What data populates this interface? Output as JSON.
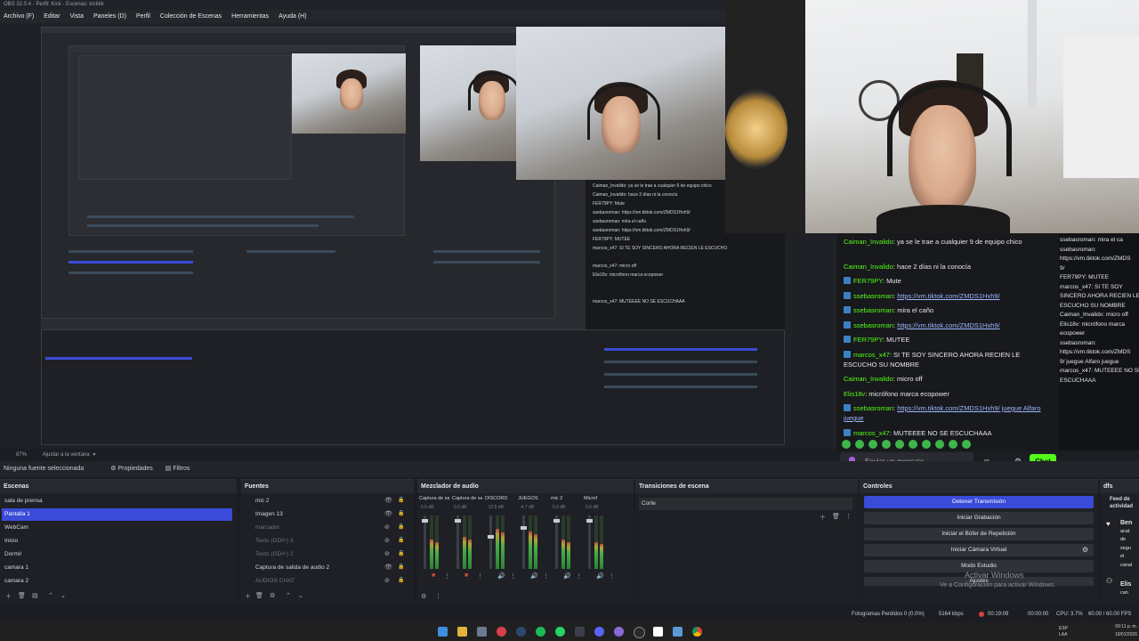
{
  "window": {
    "title": "OBS 32.0.4 - Perfil: Kick - Escenas: kickkk"
  },
  "menu": [
    "Archivo (F)",
    "Editar",
    "Vista",
    "Paneles (D)",
    "Perfil",
    "Colección de Escenas",
    "Herramientas",
    "Ayuda (H)"
  ],
  "zoom": {
    "value": "87%",
    "fit": "Ajustar a la ventana"
  },
  "source_bar": {
    "none_selected": "Ninguna fuente seleccionada",
    "properties": "Propiedades",
    "filters": "Filtros"
  },
  "chat": {
    "messages": [
      {
        "user": "Caiman_Invalido",
        "text": "ya se le trae a cualquier 9 de equipo chico",
        "badge": false
      },
      {
        "user": "Caiman_Invalido",
        "text": "hace 2 días ni la conocía",
        "badge": false
      },
      {
        "user": "FER79PY",
        "text": "Mute",
        "badge": true
      },
      {
        "user": "ssebasroman",
        "text": "https://vm.tiktok.com/ZMDS1Hxh9/",
        "badge": true,
        "link": true
      },
      {
        "user": "ssebasroman",
        "text": "mira el caño",
        "badge": true
      },
      {
        "user": "ssebasroman",
        "text": "https://vm.tiktok.com/ZMDS1Hxh9/",
        "badge": true,
        "link": true
      },
      {
        "user": "FER79PY",
        "text": "MUTEE",
        "badge": true
      },
      {
        "user": "marcos_x47",
        "text": "SI TE SOY SINCERO AHORA RECIEN LE ESCUCHO SU NOMBRE",
        "badge": true
      },
      {
        "user": "Caiman_Invalido",
        "text": "micro off",
        "badge": false
      },
      {
        "user": "Elis18v",
        "text": "micrófono marca ecopower",
        "badge": false
      },
      {
        "user": "ssebasroman",
        "text": "https://vm.tiktok.com/ZMDS1Hxh9/ juegue Alfaro juegue",
        "badge": true,
        "link": true
      },
      {
        "user": "marcos_x47",
        "text": "MUTEEEE NO SE ESCUCHAAA",
        "badge": true
      }
    ],
    "input_placeholder": "Enviar un mensaje",
    "send_label": "Chat",
    "right_column": [
      "ssebasroman: mira el ca",
      "ssebasroman:",
      "https://vm.tiktok.com/ZMDS",
      "9/",
      "FER79PY: MUTEE",
      "marcos_x47: SI TE SOY",
      "SINCERO AHORA RECIEN LE",
      "ESCUCHO SU NOMBRE",
      "Caiman_Invalido: micro off",
      "Elis18v: micrófono marca",
      "ecopower",
      "ssebasroman:",
      "https://vm.tiktok.com/ZMDS",
      "9/ juegue Alfaro juegue",
      "marcos_x47: MUTEEEE NO SE",
      "ESCUCHAAA"
    ]
  },
  "scenes": {
    "title": "Escenas",
    "items": [
      "sala de prensa",
      "Pantalla 1",
      "WebCam",
      "Inicio",
      "Dormir",
      "camara 1",
      "camara 2"
    ],
    "selected": 1
  },
  "sources": {
    "title": "Fuentes",
    "items": [
      {
        "label": "mic 2",
        "visible": true
      },
      {
        "label": "Imagen 13",
        "visible": true
      },
      {
        "label": "marcador",
        "visible": false
      },
      {
        "label": "Texto (GDI+) 3",
        "visible": false
      },
      {
        "label": "Texto (GDI+) 2",
        "visible": false
      },
      {
        "label": "Captura de salida de audio 2",
        "visible": true
      },
      {
        "label": "AUDIOS CHAT",
        "visible": false
      }
    ]
  },
  "mixer": {
    "title": "Mezclador de audio",
    "channels": [
      {
        "name": "Captura de salida d",
        "db": "0.0 dB"
      },
      {
        "name": "Captura de salida d",
        "db": "0.0 dB"
      },
      {
        "name": "DISCORD",
        "db": "-12.5 dB"
      },
      {
        "name": "JUEGOS",
        "db": "-4.7 dB"
      },
      {
        "name": "mic 2",
        "db": "0.0 dB"
      },
      {
        "name": "Microf",
        "db": "0.0 dB"
      }
    ]
  },
  "transitions": {
    "title": "Transiciones de escena",
    "value": "Corte"
  },
  "controls": {
    "title": "Controles",
    "buttons": [
      "Detener Transmisión",
      "Iniciar Grabación",
      "Iniciar el Búfer de Repetición",
      "Iniciar Cámara Virtual",
      "Modo Estudio",
      "Ajustes"
    ]
  },
  "activity": {
    "title": "Feed de actividad",
    "tab": "dfs",
    "items": [
      "Ben",
      "acat",
      "de",
      "segu",
      "el",
      "canal",
      "Elis",
      "can"
    ]
  },
  "watermark": {
    "line1": "Activar Windows",
    "line2": "Ve a Configuración para activar Windows."
  },
  "status": {
    "dropped": "Fotogramas Perdidos 0 (0.0%)",
    "bitrate": "5164 kbps",
    "live_time": "00:19:09",
    "rec_time": "00:00:00",
    "cpu": "CPU: 3.7%",
    "fps": "60.00 / 60.00 FPS"
  },
  "clock": {
    "time": "09:11 p. m.",
    "date": "19/01/2026",
    "lang": "ESP LAA"
  },
  "colors": {
    "accent": "#3a4bd8",
    "kick_green": "#53fc18",
    "link": "#9ab8ff"
  }
}
